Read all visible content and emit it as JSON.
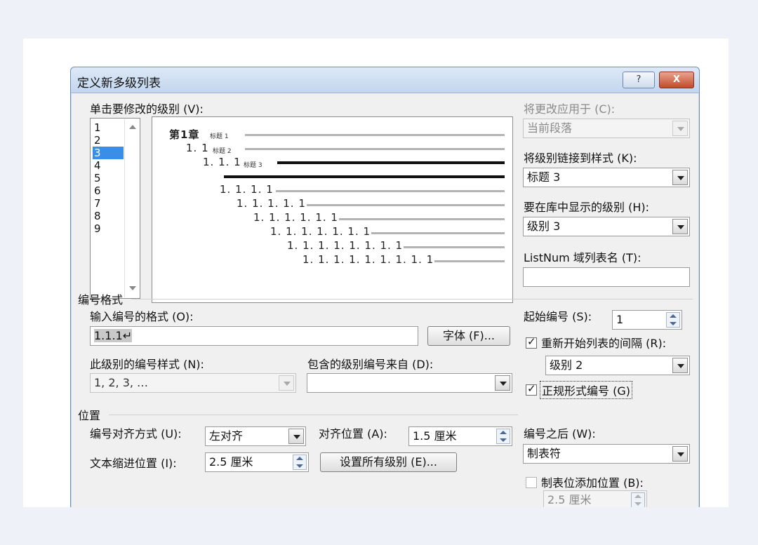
{
  "dialog": {
    "title": "定义新多级列表",
    "help_label": "?",
    "close_label": "X"
  },
  "levels": {
    "label": "单击要修改的级别 (V):",
    "items": [
      "1",
      "2",
      "3",
      "4",
      "5",
      "6",
      "7",
      "8",
      "9"
    ],
    "selected": "3"
  },
  "preview": {
    "lines": [
      {
        "num": "第1章",
        "tag": "标题 1"
      },
      {
        "num": "1. 1",
        "tag": "标题 2"
      },
      {
        "num": "1. 1. 1",
        "tag": "标题 3"
      },
      {
        "num": "",
        "tag": ""
      },
      {
        "num": "1. 1. 1. 1",
        "tag": ""
      },
      {
        "num": "1. 1. 1. 1. 1",
        "tag": ""
      },
      {
        "num": "1. 1. 1. 1. 1. 1",
        "tag": ""
      },
      {
        "num": "1. 1. 1. 1. 1. 1. 1",
        "tag": ""
      },
      {
        "num": "1. 1. 1. 1. 1. 1. 1. 1",
        "tag": ""
      },
      {
        "num": "1. 1. 1. 1. 1. 1. 1. 1. 1",
        "tag": ""
      }
    ]
  },
  "right_panel": {
    "apply_to_label": "将更改应用于 (C):",
    "apply_to_value": "当前段落",
    "link_style_label": "将级别链接到样式 (K):",
    "link_style_value": "标题 3",
    "gallery_level_label": "要在库中显示的级别 (H):",
    "gallery_level_value": "级别 3",
    "listnum_label": "ListNum 域列表名 (T):",
    "listnum_value": ""
  },
  "number_format": {
    "section": "编号格式",
    "format_label": "输入编号的格式 (O):",
    "format_value": "1.1.1↵",
    "font_button": "字体 (F)...",
    "style_label": "此级别的编号样式 (N):",
    "style_value": "1, 2, 3, …",
    "include_label": "包含的级别编号来自 (D):",
    "include_value": "",
    "start_label": "起始编号 (S):",
    "start_value": "1",
    "restart_label": "重新开始列表的间隔 (R):",
    "restart_checked": true,
    "restart_value": "级别 2",
    "legal_label": "正规形式编号 (G)",
    "legal_checked": true
  },
  "position": {
    "section": "位置",
    "align_label": "编号对齐方式 (U):",
    "align_value": "左对齐",
    "align_at_label": "对齐位置 (A):",
    "align_at_value": "1.5 厘米",
    "indent_label": "文本缩进位置 (I):",
    "indent_value": "2.5 厘米",
    "set_all_button": "设置所有级别 (E)...",
    "follow_label": "编号之后 (W):",
    "follow_value": "制表符",
    "tab_stop_label": "制表位添加位置 (B):",
    "tab_stop_checked": false,
    "tab_stop_value": "2.5 厘米"
  }
}
